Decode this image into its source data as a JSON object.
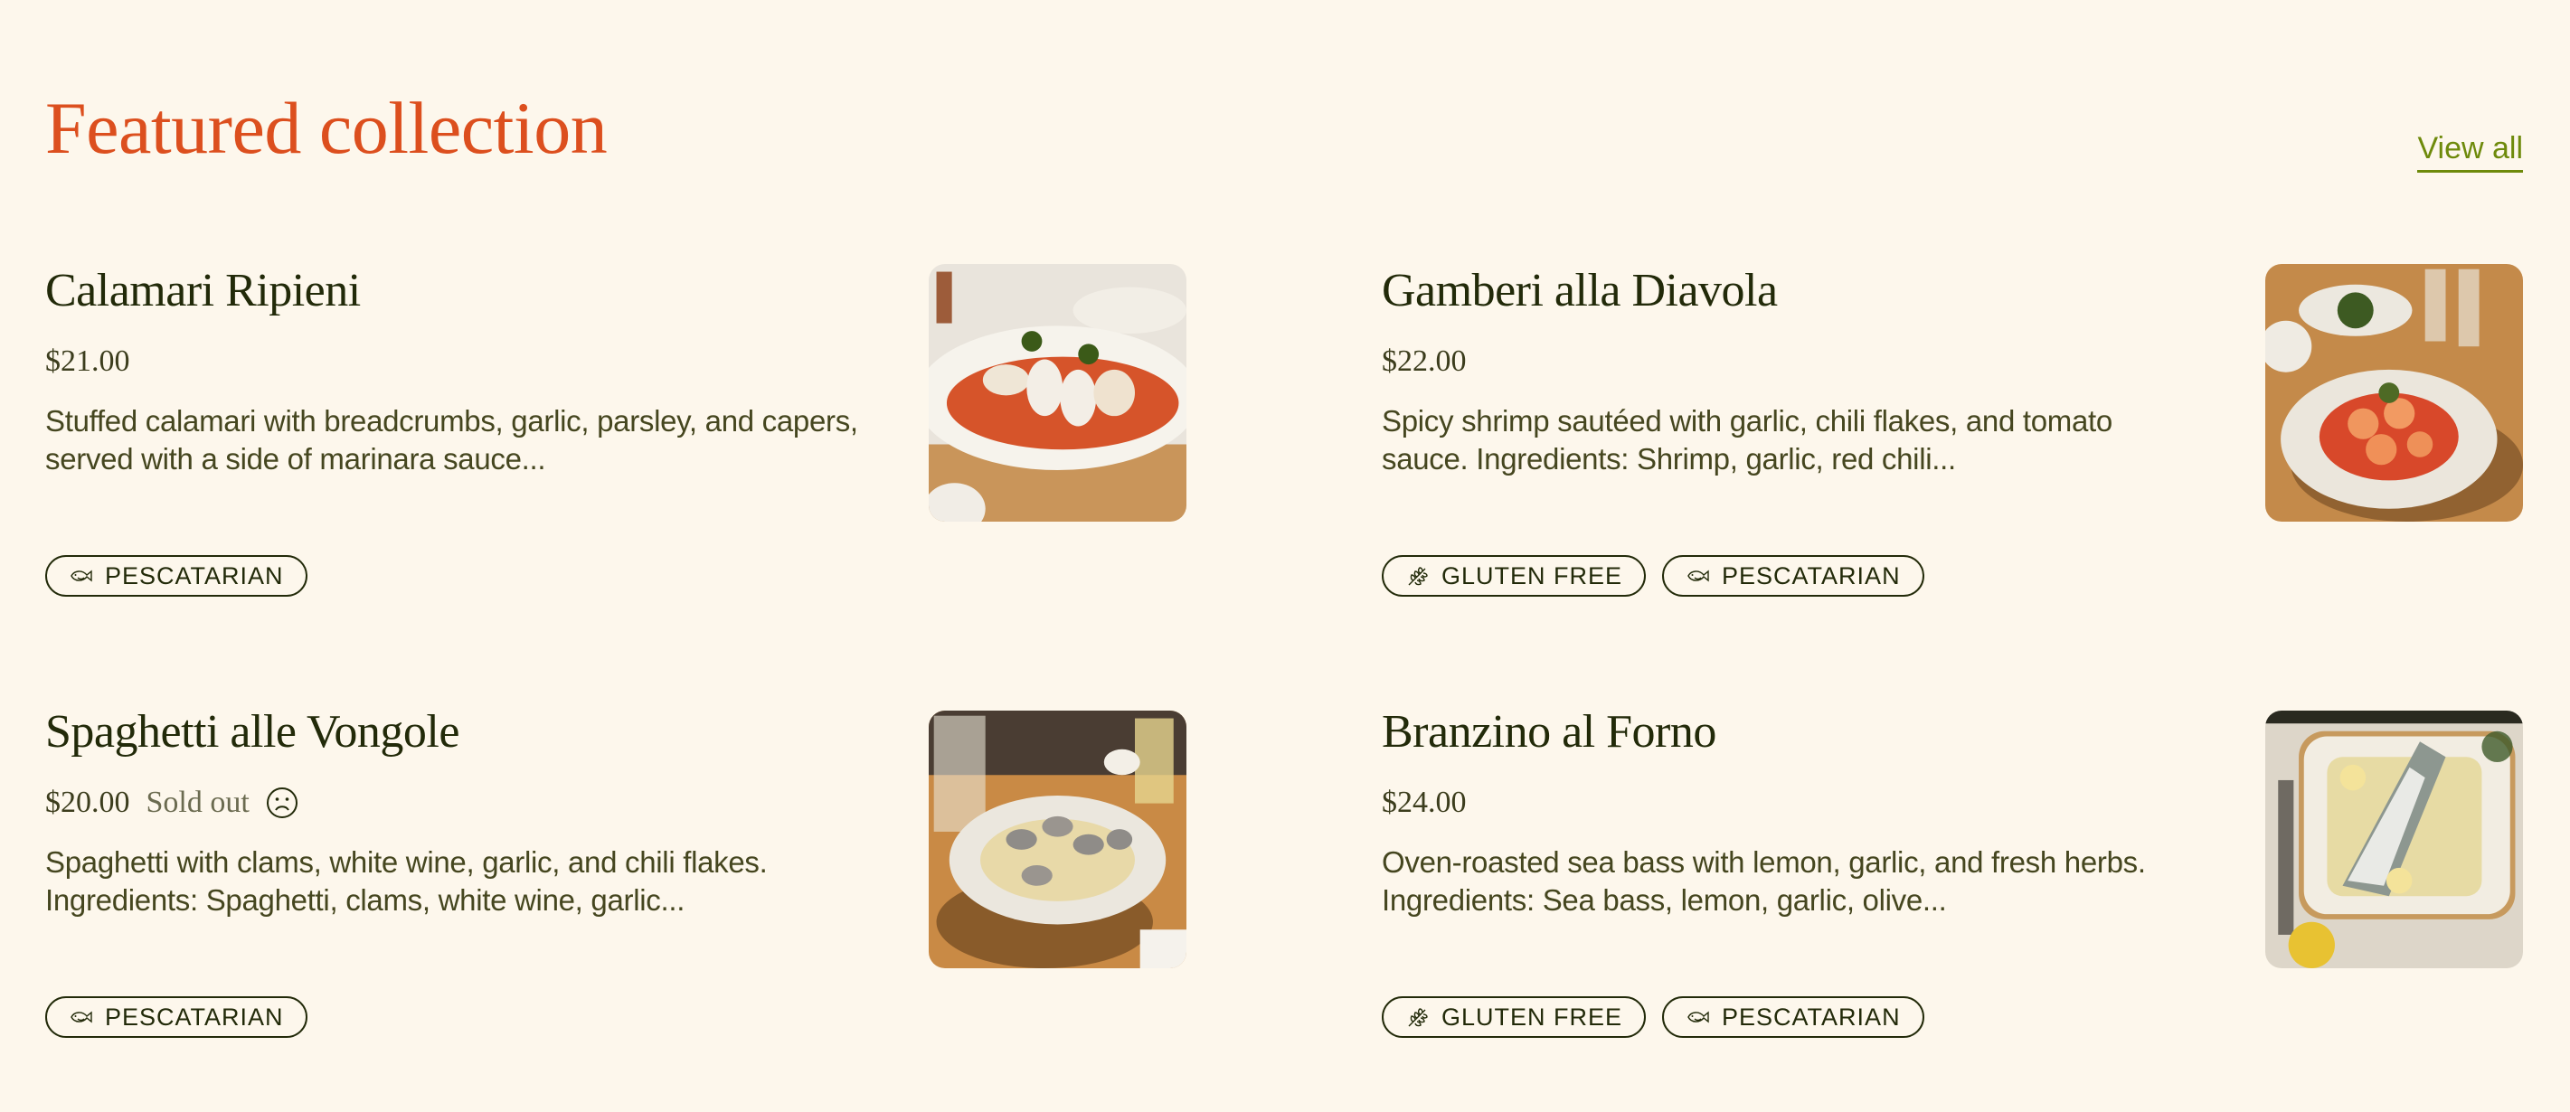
{
  "page": {
    "heading": "Featured collection",
    "view_all_label": "View all"
  },
  "colors": {
    "background": "#fdf7ec",
    "heading": "#dc4f1e",
    "link": "#6e8a0b",
    "text": "#222a09"
  },
  "products": [
    {
      "title": "Calamari Ripieni",
      "price": "$21.00",
      "sold_out": false,
      "sold_out_label": "",
      "description": "Stuffed calamari with breadcrumbs, garlic, parsley, and capers, served with a side of marinara sauce...",
      "image_alt": "Stuffed calamari on marinara sauce",
      "tags": [
        {
          "label": "PESCATARIAN",
          "icon": "fish-icon"
        }
      ]
    },
    {
      "title": "Gamberi alla Diavola",
      "price": "$22.00",
      "sold_out": false,
      "sold_out_label": "",
      "description": "Spicy shrimp sautéed with garlic, chili flakes, and tomato sauce. Ingredients: Shrimp, garlic, red chili...",
      "image_alt": "Spicy shrimp in tomato sauce",
      "tags": [
        {
          "label": "GLUTEN FREE",
          "icon": "wheat-icon"
        },
        {
          "label": "PESCATARIAN",
          "icon": "fish-icon"
        }
      ]
    },
    {
      "title": "Spaghetti alle Vongole",
      "price": "$20.00",
      "sold_out": true,
      "sold_out_label": "Sold out",
      "description": "Spaghetti with clams, white wine, garlic, and chili flakes. Ingredients: Spaghetti, clams, white wine, garlic...",
      "image_alt": "Spaghetti with clams",
      "tags": [
        {
          "label": "PESCATARIAN",
          "icon": "fish-icon"
        }
      ]
    },
    {
      "title": "Branzino al Forno",
      "price": "$24.00",
      "sold_out": false,
      "sold_out_label": "",
      "description": "Oven-roasted sea bass with lemon, garlic, and fresh herbs. Ingredients: Sea bass, lemon, garlic, olive...",
      "image_alt": "Oven-roasted sea bass with lemon",
      "tags": [
        {
          "label": "GLUTEN FREE",
          "icon": "wheat-icon"
        },
        {
          "label": "PESCATARIAN",
          "icon": "fish-icon"
        }
      ]
    }
  ]
}
